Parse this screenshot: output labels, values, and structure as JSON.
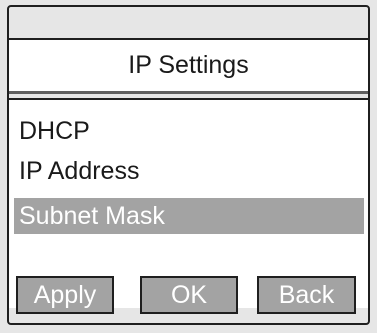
{
  "screen": {
    "title": "IP Settings"
  },
  "menu": {
    "items": [
      {
        "label": "DHCP",
        "selected": false
      },
      {
        "label": "IP Address",
        "selected": false
      },
      {
        "label": "Subnet Mask",
        "selected": true
      }
    ]
  },
  "softkeys": {
    "apply_label": "Apply",
    "ok_label": "OK",
    "back_label": "Back"
  },
  "colors": {
    "background": "#e6e6e6",
    "panel": "#ffffff",
    "highlight": "#a3a3a3",
    "border": "#1f1f1f",
    "text": "#1a1a1a",
    "highlight_text": "#ffffff"
  }
}
